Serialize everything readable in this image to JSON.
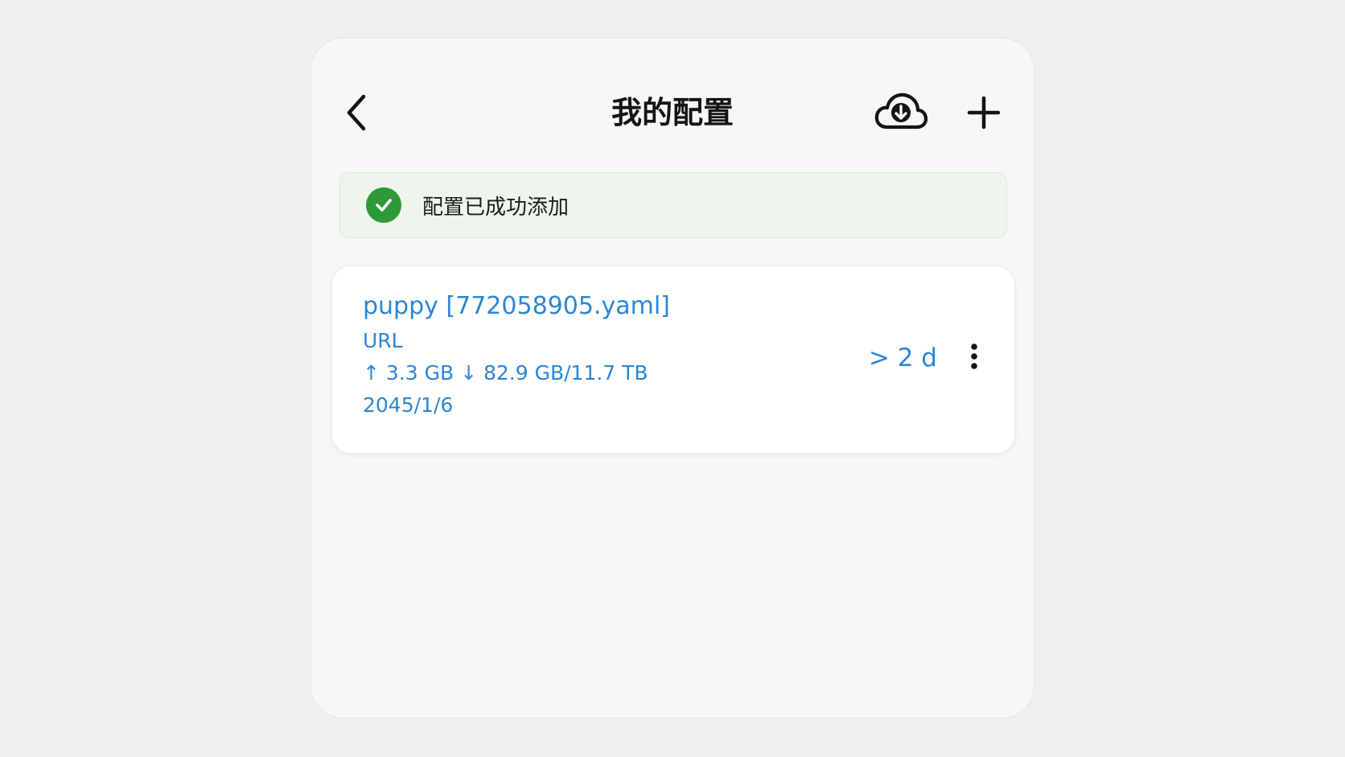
{
  "header": {
    "title": "我的配置"
  },
  "toast": {
    "message": "配置已成功添加",
    "color": "#2e9a37"
  },
  "profiles": [
    {
      "name": "puppy [772058905.yaml]",
      "type": "URL",
      "traffic": "↑ 3.3 GB ↓ 82.9 GB/11.7 TB",
      "expire": "2045/1/6",
      "update": "> 2 d"
    }
  ],
  "colors": {
    "accent": "#2c86d2",
    "success": "#2e9a37"
  },
  "icons": {
    "back": "chevron-left-icon",
    "import": "cloud-download-icon",
    "add": "plus-icon",
    "success": "check-circle-icon",
    "more": "more-vertical-icon"
  }
}
